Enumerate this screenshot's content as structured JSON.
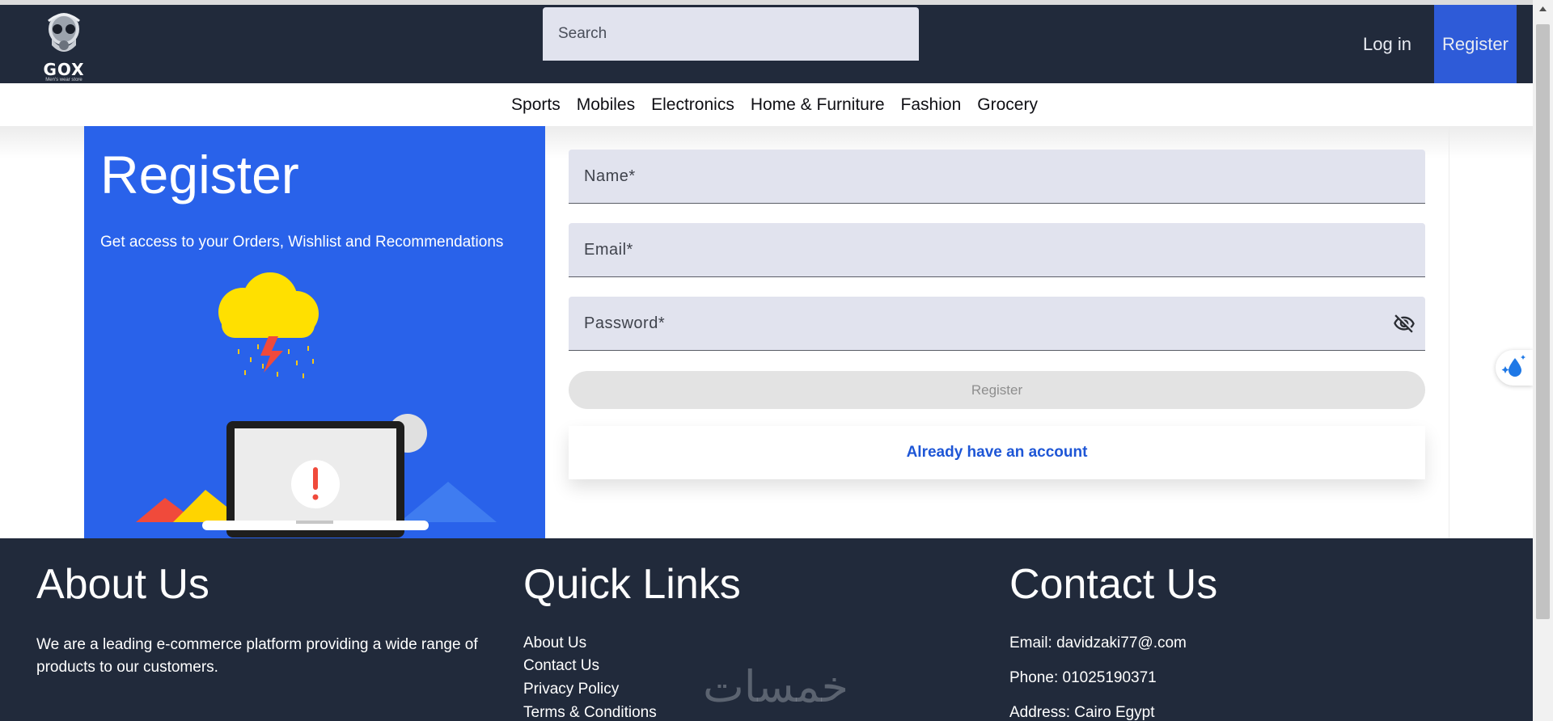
{
  "header": {
    "logo_title": "GOX",
    "logo_subtitle": "Men's wear store",
    "search_placeholder": "Search",
    "login_label": "Log in",
    "register_label": "Register"
  },
  "categories": [
    "Sports",
    "Mobiles",
    "Electronics",
    "Home & Furniture",
    "Fashion",
    "Grocery"
  ],
  "promo": {
    "title": "Register",
    "subtitle": "Get access to your Orders, Wishlist and Recommendations"
  },
  "form": {
    "name_placeholder": "Name*",
    "email_placeholder": "Email*",
    "password_placeholder": "Password*",
    "submit_label": "Register",
    "already_label": "Already have an account"
  },
  "footer": {
    "about_title": "About Us",
    "about_text": "We are a leading e-commerce platform providing a wide range of products to our customers.",
    "links_title": "Quick Links",
    "links": [
      "About Us",
      "Contact Us",
      "Privacy Policy",
      "Terms & Conditions"
    ],
    "contact_title": "Contact Us",
    "contact_email": "Email: davidzaki77@.com",
    "contact_phone": "Phone: 01025190371",
    "contact_address": "Address: Cairo Egypt",
    "watermark_text": "خمسات"
  },
  "icons": {
    "eye": "eye-off-icon",
    "widget": "water-drop-sparkle-icon",
    "logo": "skull-gasmask-logo"
  },
  "colors": {
    "nav_bg": "#212a3b",
    "accent": "#2962ea",
    "field_bg": "#e1e3ee",
    "link": "#1e56d6"
  }
}
